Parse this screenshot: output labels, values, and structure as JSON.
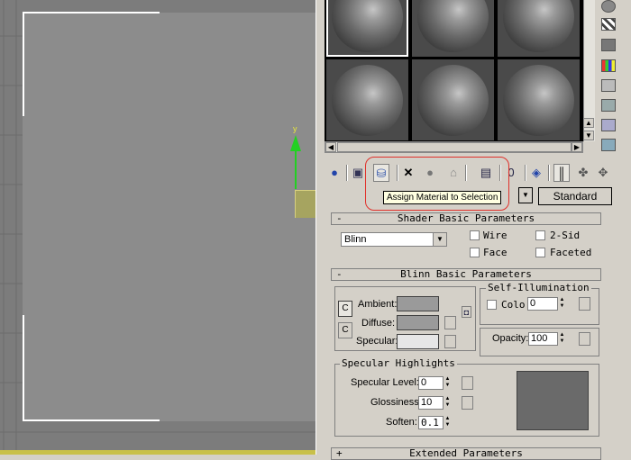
{
  "viewport": {
    "axis_label": "y"
  },
  "material_editor": {
    "tooltip": "Assign Material to Selection",
    "material_type": "Standard",
    "shader_rollout": {
      "sign": "-",
      "title": "Shader Basic Parameters",
      "shader": "Blinn",
      "wire_label": "Wirе",
      "two_sided_label": "2-Sid",
      "face_map_label": "Face",
      "faceted_label": "Faceted"
    },
    "blinn_rollout": {
      "sign": "-",
      "title": "Blinn Basic Parameters",
      "ambient_label": "Ambient:",
      "diffuse_label": "Diffuse:",
      "specular_label": "Specular:",
      "self_illum_title": "Self-Illumination",
      "color_label": "Colo",
      "color_value": "0",
      "opacity_label": "Opacity:",
      "opacity_value": "100",
      "ambient_color": "#9a9a9a",
      "diffuse_color": "#9a9a9a",
      "specular_color": "#e6e6e6"
    },
    "specular_highlights": {
      "title": "Specular Highlights",
      "level_label": "Specular Level:",
      "level_value": "0",
      "gloss_label": "Glossiness:",
      "gloss_value": "10",
      "soften_label": "Soften:",
      "soften_value": "0.1"
    },
    "extended_rollout": {
      "sign": "+",
      "title": "Extended Parameters"
    }
  }
}
